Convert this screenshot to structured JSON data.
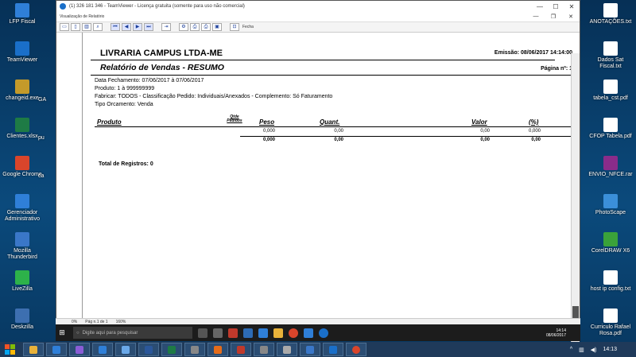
{
  "desktop_left": [
    {
      "label": "LFP Fiscal",
      "color": "#2f7fd8"
    },
    {
      "label": "TeamViewer",
      "color": "#1a6fc9"
    },
    {
      "label": "changeid.exe",
      "color": "#c49a2a"
    },
    {
      "label": "Clientes.xlsx",
      "color": "#1e7b45"
    },
    {
      "label": "Google Chrome",
      "color": "#d9452b"
    },
    {
      "label": "Gerenciador Administrativo",
      "color": "#2f7fd8"
    },
    {
      "label": "Mozilla Thunderbird",
      "color": "#3a77c8"
    },
    {
      "label": "LiveZilla",
      "color": "#2db24a"
    },
    {
      "label": "Deskzilla",
      "color": "#3d6fb0"
    }
  ],
  "desktop_left_partial": [
    "GA",
    "pu",
    "ca"
  ],
  "desktop_right": [
    {
      "label": "ANOTAÇÕES.txt",
      "color": "#ffffff"
    },
    {
      "label": "Dados Sat Fiscal.txt",
      "color": "#ffffff"
    },
    {
      "label": "tabela_cst.pdf",
      "color": "#ffffff"
    },
    {
      "label": "CFOP Tabela.pdf",
      "color": "#ffffff"
    },
    {
      "label": "ENVIO_NFCE.rar",
      "color": "#8a2c8a"
    },
    {
      "label": "PhotoScape",
      "color": "#3b8fd9"
    },
    {
      "label": "CorelDRAW X6",
      "color": "#3aa23a"
    },
    {
      "label": "host ip config.txt",
      "color": "#ffffff"
    },
    {
      "label": "Curriculo Rafael Rosa.pdf",
      "color": "#ffffff"
    }
  ],
  "teamviewer": {
    "title": "(1) 326 181 346 - TeamViewer - Licença gratuita (somente para uso não comercial)"
  },
  "inner_window": {
    "title": "Visualização de Relatório",
    "toolbar_fecha": "Fecha"
  },
  "report": {
    "company": "LIVRARIA CAMPUS LTDA-ME",
    "emissao": "Emissão: 08/06/2017 14:14:00",
    "title": "Relatório de Vendas - RESUMO",
    "pagina": "Página nº: 1",
    "meta": [
      "Data Fechamento: 07/06/2017 à 07/06/2017",
      "Produto: 1 à 999999999",
      "Fabricar: TODOS - Classificação Pedido: Individuais/Anexados - Complemento: Só Faturamento",
      "Tipo Orcamento: Venda"
    ],
    "columns": {
      "produto": "Produto",
      "qtde_pedidos": "Qtde Pedidos",
      "peso": "Peso",
      "quant": "Quant.",
      "valor": "Valor",
      "percent": "(%)"
    },
    "row": {
      "peso": "0,000",
      "quant": "0,00",
      "valor": "0,00",
      "percent": "0,000"
    },
    "totals": {
      "peso": "0,000",
      "quant": "0,00",
      "valor": "0,00",
      "percent": "0,00"
    },
    "total_registros": "Total de Registros: 0"
  },
  "status_bar": {
    "zoom_left": "0%",
    "page": "Pág n.1 de 1",
    "zoom": "160%"
  },
  "remote_taskbar": {
    "search_placeholder": "Digite aqui para pesquisar",
    "time": "14:14",
    "date": "08/06/2017"
  },
  "taskbar": {
    "time": "14:13"
  }
}
